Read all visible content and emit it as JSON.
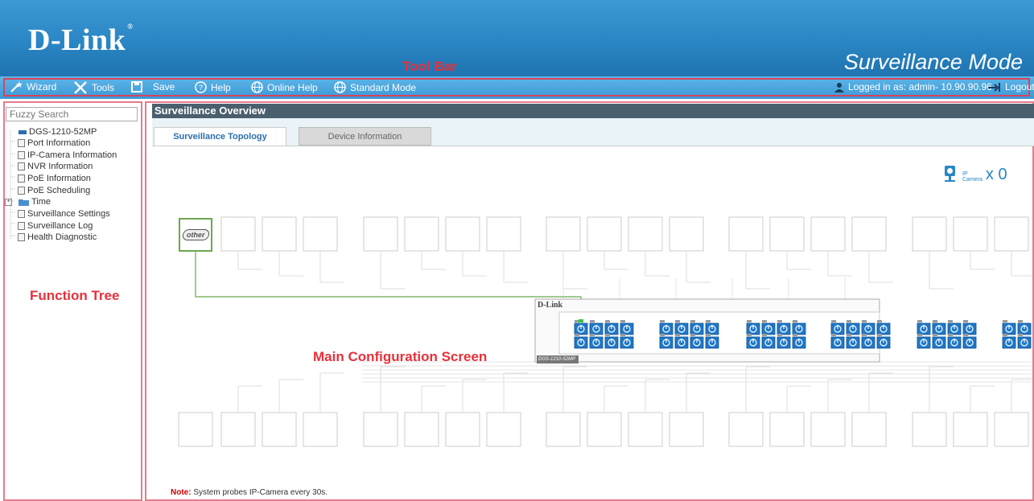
{
  "header": {
    "logo": "D-Link",
    "mode_title": "Surveillance Mode"
  },
  "annotations": {
    "toolbar": "Tool Bar",
    "function_tree": "Function Tree",
    "main_screen": "Main Configuration Screen"
  },
  "toolbar": {
    "wizard": "Wizard",
    "tools": "Tools",
    "save": "Save",
    "help": "Help",
    "online_help": "Online Help",
    "standard_mode": "Standard Mode",
    "logged_in": "Logged in as: admin- 10.90.90.96",
    "logout": "Logout"
  },
  "sidebar": {
    "search_placeholder": "Fuzzy Search",
    "items": [
      {
        "label": "DGS-1210-52MP",
        "icon": "switch-icon"
      },
      {
        "label": "Port Information",
        "icon": "document-icon"
      },
      {
        "label": "IP-Camera Information",
        "icon": "document-icon"
      },
      {
        "label": "NVR Information",
        "icon": "document-icon"
      },
      {
        "label": "PoE Information",
        "icon": "document-icon"
      },
      {
        "label": "PoE Scheduling",
        "icon": "document-icon"
      },
      {
        "label": "Time",
        "icon": "folder-icon"
      },
      {
        "label": "Surveillance Settings",
        "icon": "document-icon"
      },
      {
        "label": "Surveillance Log",
        "icon": "document-icon"
      },
      {
        "label": "Health Diagnostic",
        "icon": "document-icon"
      }
    ]
  },
  "main": {
    "title": "Surveillance Overview",
    "tabs": [
      {
        "label": "Surveillance Topology",
        "active": true
      },
      {
        "label": "Device Information",
        "active": false
      }
    ],
    "ipcam": {
      "label_top": "IP",
      "label_bottom": "Camera",
      "count": "x 0"
    },
    "other_label": "other",
    "switch": {
      "brand": "D-Link",
      "model": "DGS-1210-52MP"
    },
    "note_label": "Note:",
    "note_text": " System probes IP-Camera every 30s."
  },
  "colors": {
    "header": "#2a86c4",
    "toolbar": "#4aa8e0",
    "overview_bar": "#4a5f6e",
    "annotation": "#e8303a",
    "port": "#1f78c8"
  }
}
